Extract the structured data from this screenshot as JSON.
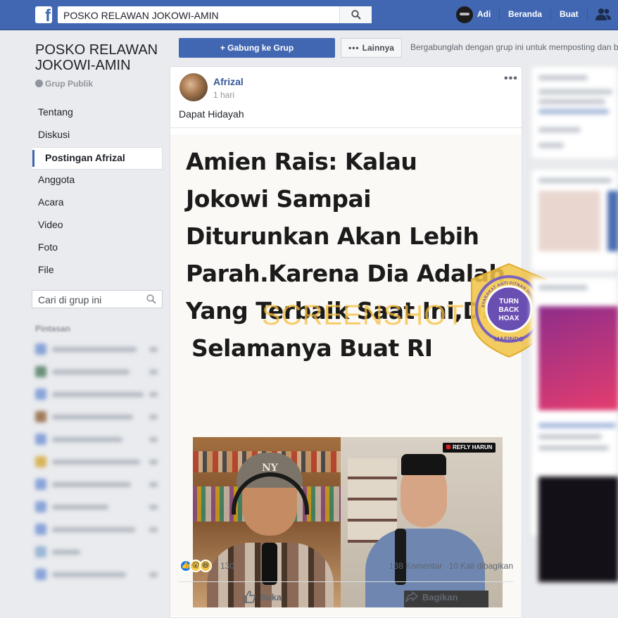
{
  "topbar": {
    "search_query": "POSKO RELAWAN JOKOWI-AMIN",
    "user_name": "Adi",
    "home_label": "Beranda",
    "create_label": "Buat"
  },
  "group": {
    "title": "POSKO RELAWAN JOKOWI-AMIN",
    "type": "Grup Publik",
    "join_button": "Gabung ke Grup",
    "more_button": "Lainnya",
    "join_hint": "Bergabunglah dengan grup ini untuk memposting dan b"
  },
  "sidebar": {
    "items": [
      {
        "label": "Tentang"
      },
      {
        "label": "Diskusi"
      },
      {
        "label": "Postingan Afrizal"
      },
      {
        "label": "Anggota"
      },
      {
        "label": "Acara"
      },
      {
        "label": "Video"
      },
      {
        "label": "Foto"
      },
      {
        "label": "File"
      }
    ],
    "search_placeholder": "Cari di grup ini",
    "shortcuts_heading": "Pintasan"
  },
  "post": {
    "author": "Afrizal",
    "time": "1 hari",
    "text": "Dapat Hidayah",
    "image": {
      "headline_lines": [
        "Amien Rais: Kalau",
        "Jokowi Sampai",
        "Diturunkan Akan Lebih",
        "Parah.Karena Dia Adalah",
        "Yang Terbaik Saat Ini,Dan",
        "Selamanya Buat RI"
      ],
      "watermark": "SCREENSHOT BY",
      "badge_center": [
        "TURN",
        "BACK",
        "HOAX"
      ],
      "badge_top": "MASYARAKAT ANTI FITNAH INDONESIA",
      "badge_bottom": "MAFINDO",
      "photo_tag": "REFLY HARUN",
      "cap_logo": "NY"
    },
    "reaction_count": "130",
    "comments": "138 Komentar",
    "shares": "10 Kali dibagikan",
    "like_label": "Suka",
    "share_label": "Bagikan"
  },
  "colors": {
    "topbar": "#4267b2",
    "link": "#365899",
    "watermark": "#f5be3c",
    "badge": "#6a4fb3"
  }
}
